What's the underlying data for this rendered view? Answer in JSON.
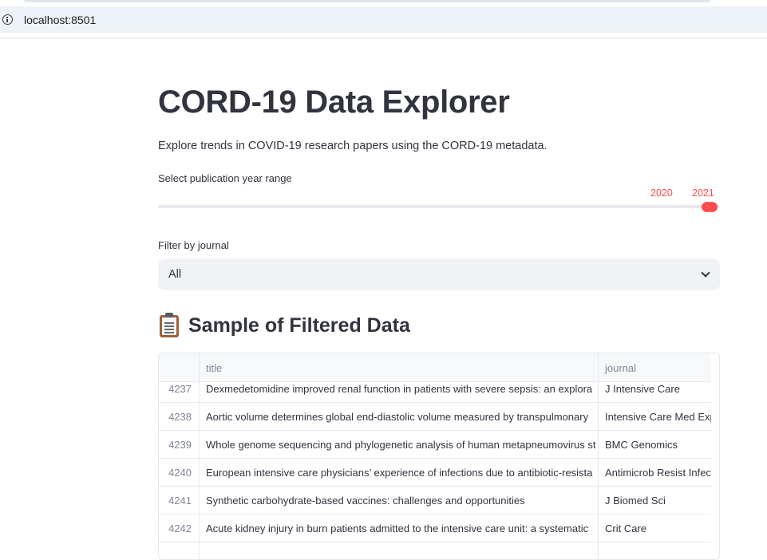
{
  "browser": {
    "url": "localhost:8501"
  },
  "app": {
    "title": "CORD-19 Data Explorer",
    "subtitle": "Explore trends in COVID-19 research papers using the CORD-19 metadata.",
    "year_slider": {
      "label": "Select publication year range",
      "min_value": "2020",
      "max_value": "2021",
      "accent_color": "#ff4b4b"
    },
    "journal_filter": {
      "label": "Filter by journal",
      "selected": "All"
    },
    "sample_section": {
      "icon": "clipboard-icon",
      "title": "Sample of Filtered Data"
    },
    "table": {
      "columns": [
        "title",
        "journal"
      ],
      "rows": [
        {
          "index": "4237",
          "title": "Dexmedetomidine improved renal function in patients with severe sepsis: an explora",
          "journal": "J Intensive Care"
        },
        {
          "index": "4238",
          "title": "Aortic volume determines global end-diastolic volume measured by transpulmonary",
          "journal": "Intensive Care Med Exp"
        },
        {
          "index": "4239",
          "title": "Whole genome sequencing and phylogenetic analysis of human metapneumovirus st",
          "journal": "BMC Genomics"
        },
        {
          "index": "4240",
          "title": "European intensive care physicians’ experience of infections due to antibiotic-resista",
          "journal": "Antimicrob Resist Infec"
        },
        {
          "index": "4241",
          "title": "Synthetic carbohydrate-based vaccines: challenges and opportunities",
          "journal": "J Biomed Sci"
        },
        {
          "index": "4242",
          "title": "Acute kidney injury in burn patients admitted to the intensive care unit: a systematic",
          "journal": "Crit Care"
        },
        {
          "index": "",
          "title": "",
          "journal": ""
        }
      ]
    }
  }
}
